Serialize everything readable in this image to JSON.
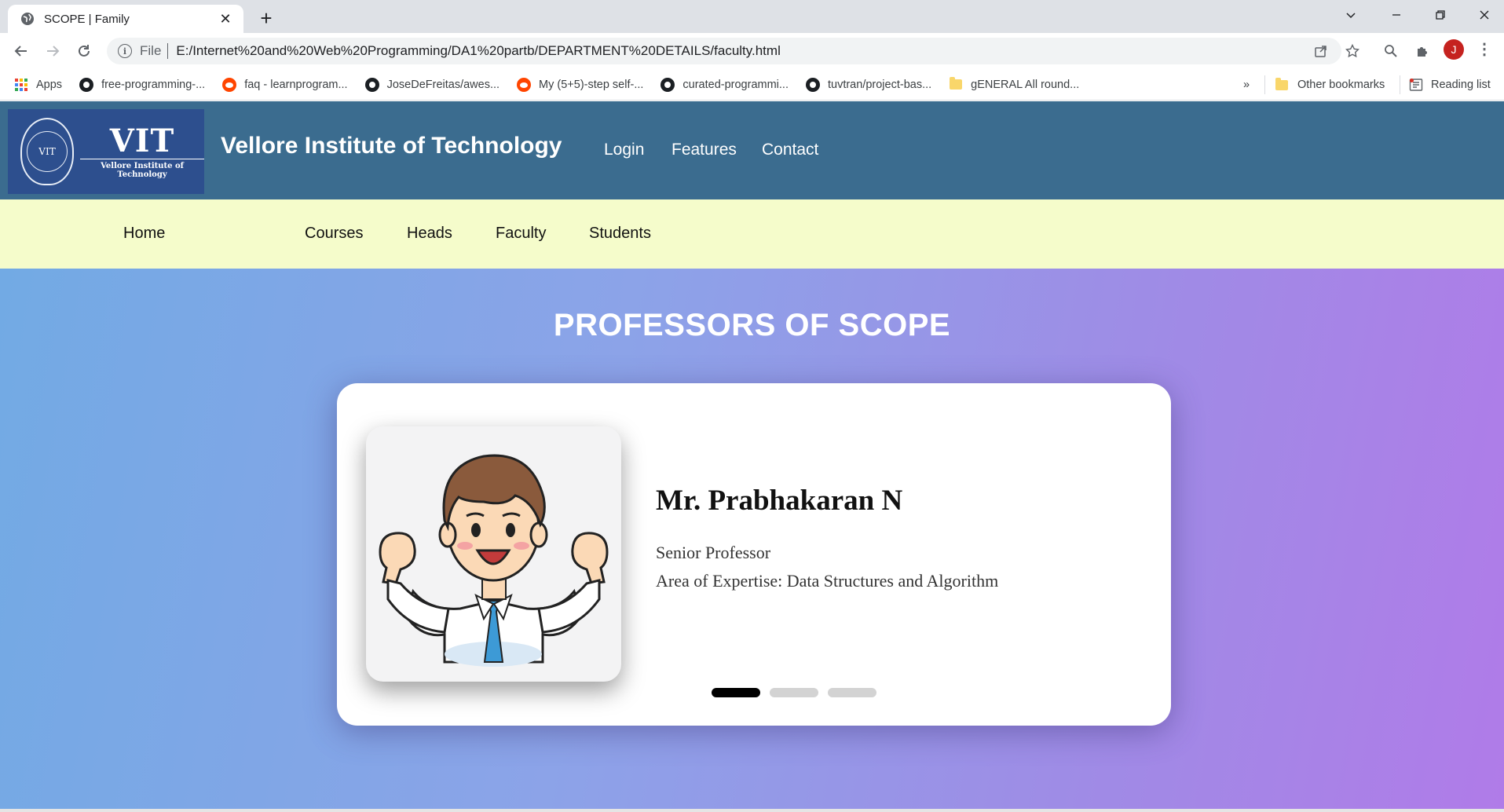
{
  "browser": {
    "tab_title": "SCOPE | Family",
    "tab_close": "✕",
    "new_tab": "+",
    "scheme_label": "File",
    "url": "E:/Internet%20and%20Web%20Programming/DA1%20partb/DEPARTMENT%20DETAILS/faculty.html",
    "profile_initial": "J",
    "bookmarks": [
      {
        "label": "Apps",
        "icon": "apps-icon"
      },
      {
        "label": "free-programming-...",
        "icon": "github-icon"
      },
      {
        "label": "faq - learnprogram...",
        "icon": "reddit-icon"
      },
      {
        "label": "JoseDeFreitas/awes...",
        "icon": "github-icon"
      },
      {
        "label": "My (5+5)-step self-...",
        "icon": "reddit-icon"
      },
      {
        "label": "curated-programmi...",
        "icon": "github-icon"
      },
      {
        "label": "tuvtran/project-bas...",
        "icon": "github-icon"
      },
      {
        "label": "gENERAL All round...",
        "icon": "folder-icon"
      }
    ],
    "overflow": "»",
    "other_bookmarks": "Other bookmarks",
    "reading_list": "Reading list"
  },
  "header": {
    "logo_text": "VIT",
    "logo_subtitle": "Vellore Institute of Technology",
    "logo_seal_text": "VIT",
    "site_title": "Vellore Institute of Technology",
    "nav": [
      "Login",
      "Features",
      "Contact"
    ]
  },
  "subnav": [
    "Home",
    "Courses",
    "Heads",
    "Faculty",
    "Students"
  ],
  "main": {
    "heading": "PROFESSORS OF SCOPE",
    "professor": {
      "name": "Mr. Prabhakaran N",
      "designation": "Senior Professor",
      "expertise": "Area of Expertise: Data Structures and Algorithm"
    },
    "slides": {
      "count": 3,
      "active": 0
    }
  },
  "colors": {
    "header_bg": "#3b6c8f",
    "subnav_bg": "#f5fccb",
    "hero_gradient_start": "#72aae4",
    "hero_gradient_end": "#b07be8",
    "logo_bg": "#2d4f8e"
  }
}
